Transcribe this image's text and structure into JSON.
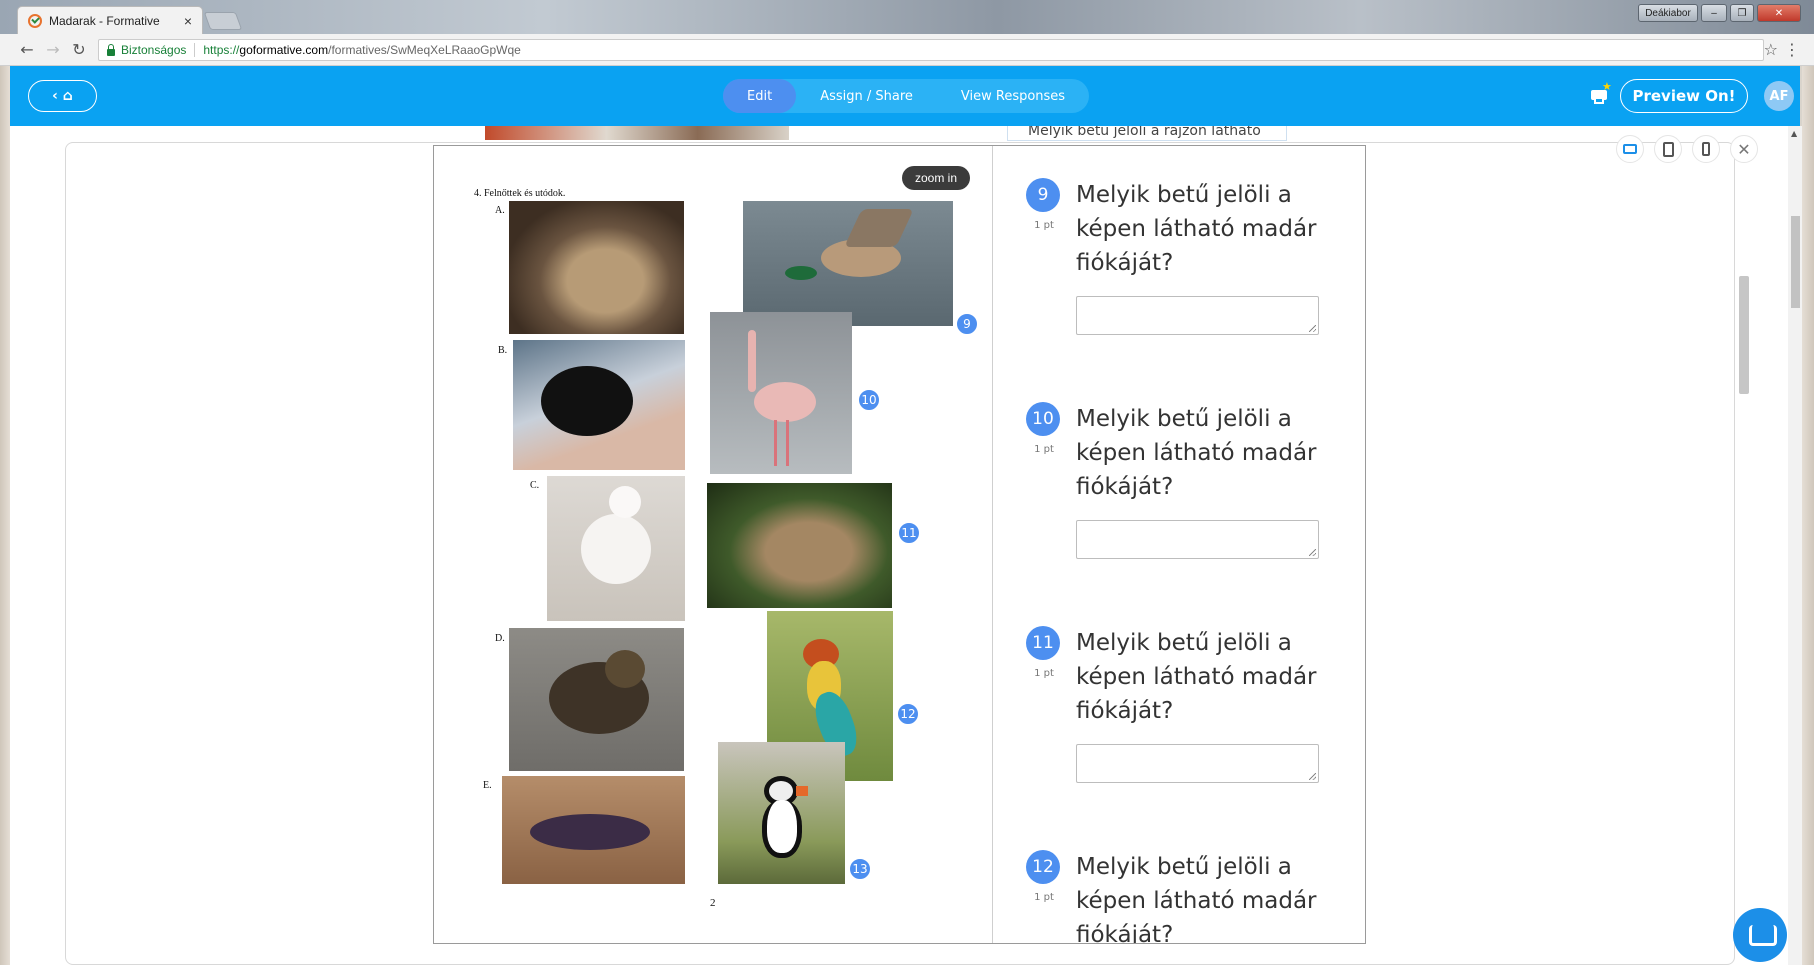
{
  "browser": {
    "tab_title": "Madarak - Formative",
    "tab_close": "×",
    "secure_label": "Biztonságos",
    "url_scheme": "https://",
    "url_host": "goformative.com",
    "url_path": "/formatives/SwMeqXeLRaaoGpWqe",
    "window_controls": {
      "user_badge": "Deákiabor",
      "minimize": "–",
      "restore": "❐",
      "close": "✕"
    },
    "back": "←",
    "forward": "→",
    "reload": "↻",
    "bookmark": "☆",
    "menu": "⋮"
  },
  "header": {
    "home_label": "‹ ⌂",
    "modes": [
      {
        "label": "Edit",
        "active": true
      },
      {
        "label": "Assign / Share",
        "active": false
      },
      {
        "label": "View Responses",
        "active": false
      }
    ],
    "preview_label": "Preview On!",
    "avatar_initials": "AF",
    "accent_color": "#0aa2f2",
    "mode_active_color": "#4d8ff0"
  },
  "peek_question": "Melyik betű jelöli a rajzon látható",
  "device_bar": {
    "close": "✕"
  },
  "worksheet": {
    "zoom_label": "zoom in",
    "title": "4.  Felnőttek és utódok.",
    "labels": [
      "A.",
      "B.",
      "C.",
      "D.",
      "E."
    ],
    "page_number": "2",
    "pins": [
      "9",
      "10",
      "11",
      "12",
      "13"
    ]
  },
  "questions": [
    {
      "number": "9",
      "points": "1 pt",
      "text": "Melyik betű jelöli a képen látható madár fiókáját?",
      "answer": ""
    },
    {
      "number": "10",
      "points": "1 pt",
      "text": "Melyik betű jelöli a képen látható madár fiókáját?",
      "answer": ""
    },
    {
      "number": "11",
      "points": "1 pt",
      "text": "Melyik betű jelöli a képen látható madár fiókáját?",
      "answer": ""
    },
    {
      "number": "12",
      "points": "1 pt",
      "text": "Melyik betű jelöli a képen látható madár fiókáját?",
      "answer": ""
    }
  ],
  "photos": [
    "chick-a-photo",
    "mallard-photo",
    "chick-b-photo",
    "flamingo-photo",
    "chick-c-photo",
    "quail-photo",
    "chick-d-photo",
    "bee-eater-photo",
    "chick-e-photo",
    "puffin-photo"
  ]
}
